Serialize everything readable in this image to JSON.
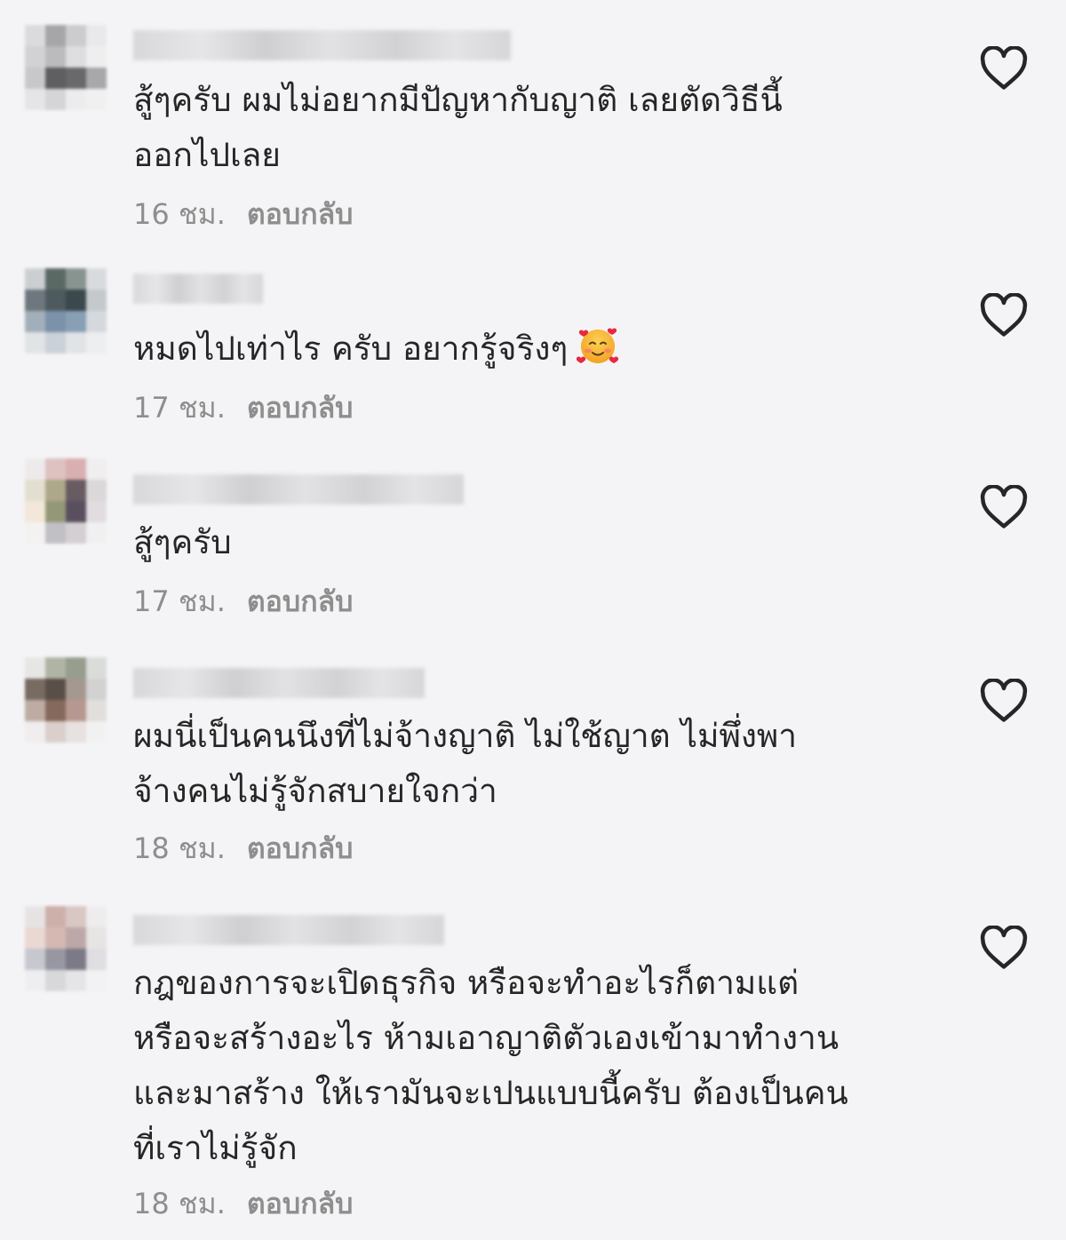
{
  "comments": [
    {
      "text": "สู้ๆครับ ผมไม่อยากมีปัญหากับญาติ เลยตัดวิธีนี้\nออกไปเลย",
      "time": "16 ชม.",
      "reply": "ตอบกลับ"
    },
    {
      "text": "หมดไปเท่าไร ครับ อยากรู้จริงๆ",
      "emoji": "smiling-face-with-hearts",
      "time": "17 ชม.",
      "reply": "ตอบกลับ"
    },
    {
      "text": "สู้ๆครับ",
      "time": "17 ชม.",
      "reply": "ตอบกลับ"
    },
    {
      "text": "ผมนี่เป็นคนนึงที่ไม่จ้างญาติ ไม่ใช้ญาต ไม่พึ่งพา\nจ้างคนไม่รู้จักสบายใจกว่า",
      "time": "18 ชม.",
      "reply": "ตอบกลับ"
    },
    {
      "text": "กฎของการจะเปิดธุรกิจ หรือจะทำอะไรก็ตามแต่\nหรือจะสร้างอะไร ห้ามเอาญาติตัวเองเข้ามาทำงาน\nและมาสร้าง ให้เรามันจะเปนแบบนี้ครับ ต้องเป็นคน\nที่เราไม่รู้จัก",
      "time": "18 ชม.",
      "reply": "ตอบกลับ"
    }
  ],
  "icons": {
    "like": "heart-outline-icon"
  },
  "colors": {
    "background": "#f4f4f6",
    "text": "#262626",
    "meta": "#8e8e8e"
  }
}
